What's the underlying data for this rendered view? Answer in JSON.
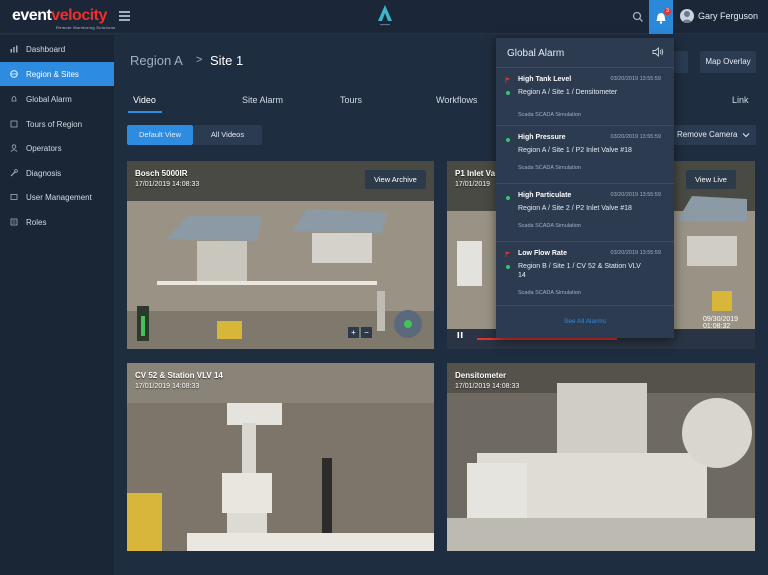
{
  "app": {
    "logo_part1": "event",
    "logo_part2": "velocity",
    "logo_sub": "Remote Monitoring Solutions",
    "user_name": "Gary Ferguson",
    "notification_count": "3"
  },
  "sidebar": {
    "items": [
      {
        "label": "Dashboard",
        "icon": "chart-icon",
        "active": false
      },
      {
        "label": "Region & Sites",
        "icon": "globe-icon",
        "active": true
      },
      {
        "label": "Global Alarm",
        "icon": "bell-icon",
        "active": false
      },
      {
        "label": "Tours of Region",
        "icon": "tour-icon",
        "active": false
      },
      {
        "label": "Operators",
        "icon": "user-icon",
        "active": false
      },
      {
        "label": "Diagnosis",
        "icon": "wrench-icon",
        "active": false
      },
      {
        "label": "User Management",
        "icon": "users-icon",
        "active": false
      },
      {
        "label": "Roles",
        "icon": "roles-icon",
        "active": false
      }
    ]
  },
  "breadcrumb": {
    "region": "Region A",
    "separator": ">",
    "site": "Site 1"
  },
  "header": {
    "map_overlay": "Map Overlay"
  },
  "tabs": [
    "Video",
    "Site Alarm",
    "Tours",
    "Workflows",
    "Link"
  ],
  "view_toggle": {
    "default": "Default View",
    "all": "All Videos"
  },
  "remove_camera": "Remove Camera",
  "cameras": [
    {
      "title": "Bosch 5000IR",
      "timestamp": "17/01/2019 14:08:33",
      "button": "View Archive"
    },
    {
      "title": "P1 Inlet Va",
      "timestamp": "17/01/2019",
      "button": "View Live",
      "footer_time": "09/30/2019 01:08:32"
    },
    {
      "title": "CV 52 & Station VLV 14",
      "timestamp": "17/01/2019 14:08:33"
    },
    {
      "title": "Densitometer",
      "timestamp": "17/01/2019 14:08:33"
    }
  ],
  "alarm_panel": {
    "title": "Global Alarm",
    "alarms": [
      {
        "name": "High Tank Level",
        "time": "03/20/2019 13:55:59",
        "location": "Region A / Site 1 / Densitometer",
        "source": "",
        "flag": true
      },
      {
        "name": "High Pressure",
        "time": "03/20/2019 13:55:59",
        "location": "Region A / Site 1 / P2 Inlet Valve #18",
        "source": "Scada   SCADA Simulation",
        "flag": false
      },
      {
        "name": "High Particulate",
        "time": "03/20/2019 13:55:59",
        "location": "Region A / Site 2 / P2 Inlet Valve #18",
        "source": "Scada   SCADA Simulation",
        "flag": false
      },
      {
        "name": "Low Flow Rate",
        "time": "03/20/2019 13:55:59",
        "location": "Region B / Site 1 / CV 52 & Station VLV 14",
        "source": "Scada   SCADA Simulation",
        "flag": true
      }
    ],
    "source_first": "Scada   SCADA Simulation",
    "see_all": "See All Alarms"
  },
  "colors": {
    "accent": "#2d8be0",
    "alarm_red": "#e8322e",
    "ok_green": "#35c86a"
  }
}
